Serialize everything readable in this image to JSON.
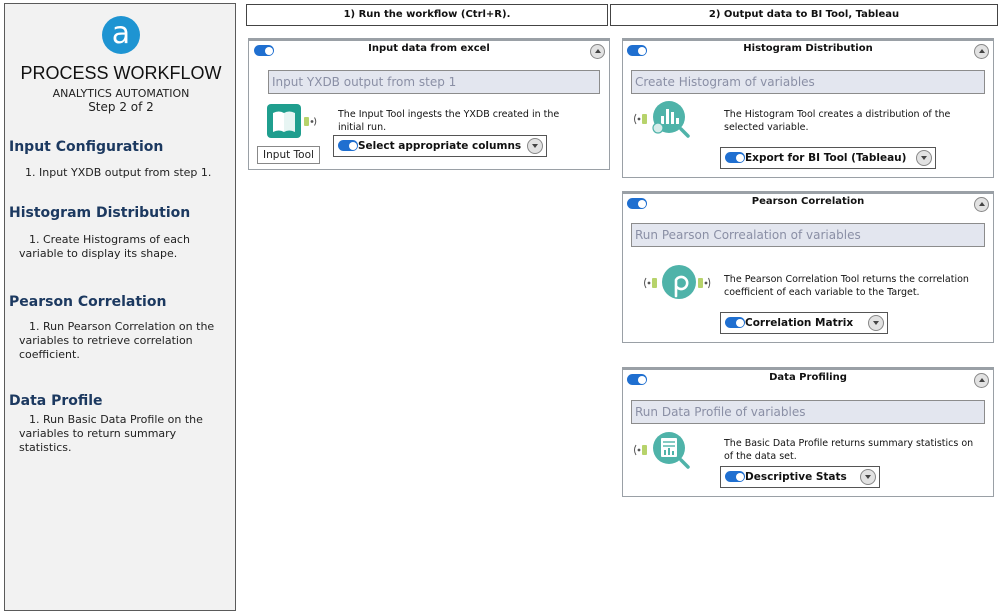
{
  "sidebar": {
    "logo_letter": "a",
    "title": "PROCESS WORKFLOW",
    "subtitle": "ANALYTICS AUTOMATION",
    "step": "Step 2 of 2",
    "sections": [
      {
        "heading": "Input Configuration",
        "text": "1. Input YXDB output from step 1."
      },
      {
        "heading": "Histogram Distribution",
        "text": "1. Create Histograms of each variable to display its shape."
      },
      {
        "heading": "Pearson Correlation",
        "text": "1. Run Pearson Correlation on the variables to retrieve correlation coefficient."
      },
      {
        "heading": "Data Profile",
        "text": "1. Run Basic Data Profile on the variables to return summary statistics."
      }
    ]
  },
  "columns": [
    {
      "label": "1) Run the workflow (Ctrl+R)."
    },
    {
      "label": "2) Output data to BI Tool, Tableau"
    }
  ],
  "panels": {
    "input": {
      "title": "Input data from excel",
      "placeholder": "Input YXDB output from step 1",
      "description": "The Input Tool ingests the YXDB created in the initial run.",
      "tool_caption": "Input Tool",
      "dropdown": "Select appropriate columns",
      "icon": "book-icon"
    },
    "histogram": {
      "title": "Histogram Distribution",
      "placeholder": "Create Histogram of variables",
      "description": "The Histogram Tool creates a distribution of the selected variable.",
      "dropdown": "Export for BI Tool (Tableau)",
      "icon": "histogram-icon"
    },
    "pearson": {
      "title": "Pearson Correlation",
      "placeholder": "Run Pearson Correalation of variables",
      "description": "The Pearson Correlation Tool returns the correlation coefficient of each variable to the Target.",
      "dropdown": "Correlation Matrix",
      "icon": "rho-icon"
    },
    "profiling": {
      "title": "Data Profiling",
      "placeholder": "Run Data Profile of variables",
      "description": "The Basic Data Profile returns summary statistics on of the data set.",
      "dropdown": "Descriptive Stats",
      "icon": "data-profile-icon"
    }
  },
  "colors": {
    "accent_blue": "#1e94d2",
    "toggle_blue": "#1f6fd0",
    "heading_navy": "#1c3960",
    "tool_teal": "#4fb3a9",
    "connector_green": "#b7d36b"
  }
}
